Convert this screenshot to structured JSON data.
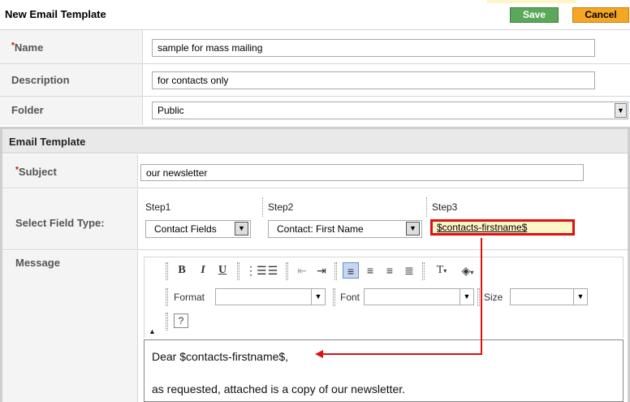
{
  "header": {
    "title": "New Email Template",
    "save_label": "Save",
    "cancel_label": "Cancel"
  },
  "general": {
    "name_label": "Name",
    "name_value": "sample for mass mailing",
    "description_label": "Description",
    "description_value": "for contacts only",
    "folder_label": "Folder",
    "folder_value": "Public",
    "required_marker": "*"
  },
  "email_template": {
    "section_title": "Email Template",
    "subject_label": "Subject",
    "subject_value": "our newsletter",
    "select_field_type_label": "Select Field Type:",
    "steps": [
      {
        "label": "Step1",
        "value": "Contact Fields"
      },
      {
        "label": "Step2",
        "value": "Contact: First Name"
      },
      {
        "label": "Step3",
        "value": "$contacts-firstname$"
      }
    ],
    "message_label": "Message"
  },
  "editor": {
    "toolbar": {
      "format_label": "Format",
      "format_value": "",
      "font_label": "Font",
      "font_value": "",
      "size_label": "Size",
      "size_value": ""
    },
    "lines": [
      "Dear $contacts-firstname$,",
      "as requested, attached is a copy of our newsletter."
    ]
  },
  "colors": {
    "save": "#5aa85a",
    "cancel": "#f5a623",
    "highlight_border": "#e01010",
    "highlight_fill": "#fdf6c8"
  },
  "icons": [
    "bold-icon",
    "italic-icon",
    "underline-icon",
    "numbered-list-icon",
    "bullet-list-icon",
    "outdent-icon",
    "indent-icon",
    "align-left-icon",
    "align-center-icon",
    "align-right-icon",
    "justify-icon",
    "text-color-icon",
    "background-color-icon",
    "help-icon",
    "collapse-toolbar-icon"
  ]
}
